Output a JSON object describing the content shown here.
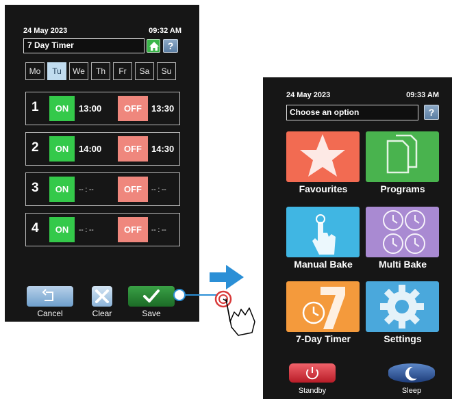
{
  "left_screen": {
    "date": "24 May 2023",
    "time": "09:32 AM",
    "title": "7 Day Timer",
    "home_icon": "home-icon",
    "help_label": "?",
    "days": [
      "Mo",
      "Tu",
      "We",
      "Th",
      "Fr",
      "Sa",
      "Su"
    ],
    "selected_day": "Tu",
    "timers": [
      {
        "num": "1",
        "on_label": "ON",
        "on_time": "13:00",
        "off_label": "OFF",
        "off_time": "13:30"
      },
      {
        "num": "2",
        "on_label": "ON",
        "on_time": "14:00",
        "off_label": "OFF",
        "off_time": "14:30"
      },
      {
        "num": "3",
        "on_label": "ON",
        "on_time": "-- : --",
        "off_label": "OFF",
        "off_time": "-- : --"
      },
      {
        "num": "4",
        "on_label": "ON",
        "on_time": "-- : --",
        "off_label": "OFF",
        "off_time": "-- : --"
      }
    ],
    "buttons": {
      "cancel": "Cancel",
      "clear": "Clear",
      "save": "Save"
    }
  },
  "right_screen": {
    "date": "24 May 2023",
    "time": "09:33 AM",
    "title": "Choose an option",
    "help_label": "?",
    "tiles": [
      {
        "label": "Favourites",
        "icon": "star-icon",
        "color": "#f26b52"
      },
      {
        "label": "Programs",
        "icon": "documents-icon",
        "color": "#49b34e"
      },
      {
        "label": "Manual Bake",
        "icon": "hand-pointer-icon",
        "color": "#40b6e3"
      },
      {
        "label": "Multi Bake",
        "icon": "multi-clock-icon",
        "color": "#a98ad2"
      },
      {
        "label": "7-Day Timer",
        "icon": "seven-clock-icon",
        "color": "#f49a3c"
      },
      {
        "label": "Settings",
        "icon": "gear-icon",
        "color": "#4aa8dc"
      }
    ],
    "standby": "Standby",
    "sleep": "Sleep"
  },
  "colors": {
    "screen_bg": "#161616",
    "on_green": "#34c94a",
    "off_red": "#ef877d",
    "arrow_blue": "#2b8fd6"
  }
}
